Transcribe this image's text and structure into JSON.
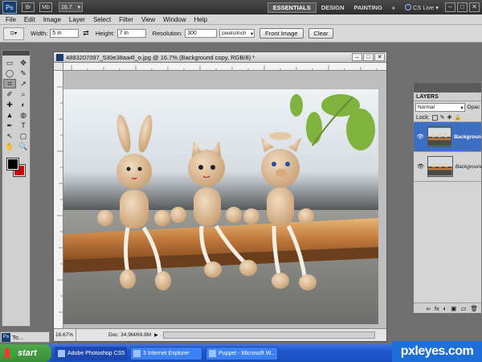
{
  "appbar": {
    "logo": "Ps",
    "bridge": "Br",
    "minibridge": "Mb",
    "zoom": "16.7",
    "workspaces": [
      "ESSENTIALS",
      "DESIGN",
      "PAINTING"
    ],
    "more": "»",
    "cs_live": "CS Live",
    "window_buttons": [
      "–",
      "□",
      "✕"
    ]
  },
  "menu": [
    "File",
    "Edit",
    "Image",
    "Layer",
    "Select",
    "Filter",
    "View",
    "Window",
    "Help"
  ],
  "options": {
    "width_label": "Width:",
    "width_value": "5 in",
    "height_label": "Height:",
    "height_value": "7 in",
    "resolution_label": "Resolution:",
    "resolution_value": "300",
    "resolution_unit": "pixels/inch",
    "front_image": "Front Image",
    "clear": "Clear"
  },
  "toolbox": {
    "tools": [
      "▭",
      "✥",
      "◯",
      "✎",
      "⌗",
      "↗",
      "✐",
      "⌕",
      "✚",
      "◐",
      "▲",
      "◍",
      "✒",
      "T",
      "↖",
      "▢",
      "✋",
      "🔍"
    ],
    "minimized_label": "To..."
  },
  "document": {
    "title": "4883207097_530e38aa4f_o.jpg @ 16.7% (Background copy, RGB/8)",
    "title_suffix": "*",
    "zoom": "16.67%",
    "doc_info": "Doc: 34.9M/69.8M"
  },
  "layers": {
    "tab": "LAYERS",
    "blend_mode": "Normal",
    "opacity_label": "Opac",
    "lock_label": "Lock:",
    "items": [
      {
        "name": "Background"
      },
      {
        "name": "Background"
      }
    ],
    "footer_icons": [
      "fx",
      "◐",
      "▣",
      "▭",
      "🗑"
    ]
  },
  "taskbar": {
    "start": "start",
    "tasks": [
      {
        "label": "Adobe Photoshop CS5"
      },
      {
        "label": "3 Internet Explorer"
      },
      {
        "label": "Puppet - Microsoft W..."
      }
    ]
  },
  "watermark": "pxleyes.com"
}
